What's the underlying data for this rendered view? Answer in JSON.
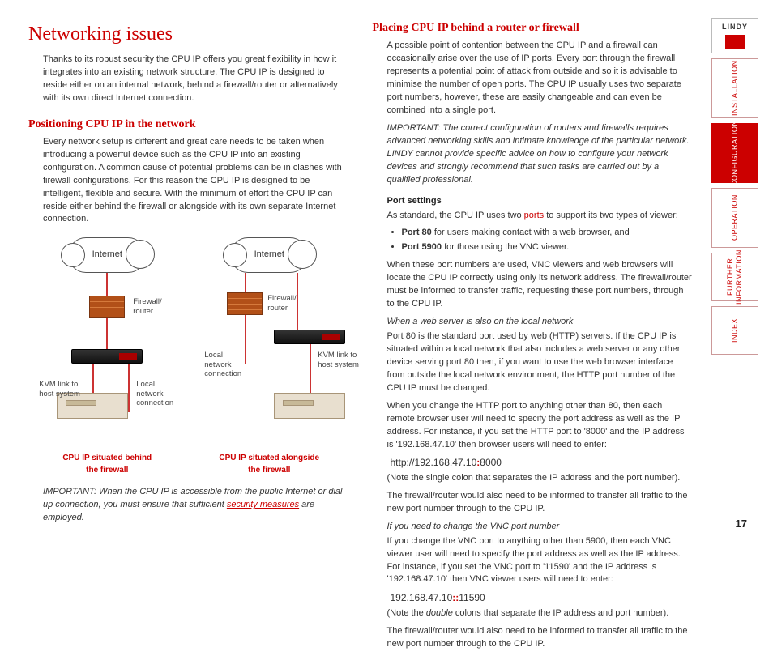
{
  "page_number": "17",
  "logo_text": "LINDY",
  "nav": {
    "installation": "INSTALLATION",
    "configuration": "CONFIGURATION",
    "operation": "OPERATION",
    "further": "FURTHER\nINFORMATION",
    "index": "INDEX"
  },
  "left": {
    "h1": "Networking issues",
    "intro": "Thanks to its robust security the CPU IP offers you great flexibility in how it integrates into an existing network structure. The CPU IP is designed to reside either on an internal network, behind a firewall/router or alternatively with its own direct Internet connection.",
    "h2_a": "Positioning CPU IP in the network",
    "para_a": "Every network setup is different and great care needs to be taken when introducing a powerful device such as the CPU IP into an existing configuration. A common cause of potential problems can be in clashes with firewall configurations. For this reason the CPU IP is designed to be intelligent, flexible and secure. With the minimum of effort the CPU IP can reside either behind the firewall or alongside with its own separate Internet connection.",
    "diagram": {
      "internet": "Internet",
      "fw_router": "Firewall/\nrouter",
      "kvm_link": "KVM link to\nhost system",
      "local_net": "Local\nnetwork\nconnection",
      "caption_left": "CPU IP situated behind\nthe firewall",
      "caption_right": "CPU IP situated alongside\nthe firewall"
    },
    "important_pre": "IMPORTANT: When the CPU IP is accessible from the public Internet or dial up connection, you must ensure that sufficient ",
    "security_link": "security measures",
    "important_post": " are employed."
  },
  "right": {
    "h2_b": "Placing CPU IP behind a router or firewall",
    "para_b1": "A possible point of contention between the CPU IP and a firewall can occasionally arise over the use of IP ports. Every port through the firewall represents a potential point of attack from outside and so it is advisable to minimise the number of open ports. The CPU IP usually uses two separate port numbers, however, these are easily changeable and can even be combined into a single port.",
    "important_b": "IMPORTANT: The correct configuration of routers and firewalls requires advanced networking skills and intimate knowledge of the particular network. LINDY cannot provide specific advice on how to configure your network devices and strongly recommend that such tasks are carried out by a qualified professional.",
    "h3_ports": "Port settings",
    "ports_intro_pre": "As standard, the CPU IP uses two ",
    "ports_link": "ports",
    "ports_intro_post": " to support its two types of viewer:",
    "port80_b": "Port 80",
    "port80_t": " for users making contact with a web browser, and",
    "port5900_b": "Port 5900",
    "port5900_t": " for those using the VNC viewer.",
    "ports_after": "When these port numbers are used, VNC viewers and web browsers will locate the CPU IP correctly using only its network address. The firewall/router must be informed to transfer traffic, requesting these port numbers, through to the CPU IP.",
    "sub_web": "When a web server is also on the local network",
    "web_p1": "Port 80 is the standard port used by web (HTTP) servers. If the CPU IP is situated within a local network that also includes a web server or any other device serving port 80 then, if you want to use the web browser interface from outside the local network environment, the HTTP port number of the CPU IP must be changed.",
    "web_p2": "When you change the HTTP port to anything other than 80, then each remote browser user will need to specify the port address as well as the IP address. For instance, if you set the HTTP port to '8000' and the IP address is '192.168.47.10' then browser users will need to enter:",
    "http_example_pre": "http://192.168.47.10",
    "http_example_colon": ":",
    "http_example_post": "8000",
    "web_note": "(Note the single colon that separates the IP address and the port number).",
    "web_p3": "The firewall/router would also need to be informed to transfer all traffic to the new port number through to the CPU IP.",
    "sub_vnc": "If you need to change the VNC port number",
    "vnc_p1": "If you change the VNC port to anything other than 5900, then each VNC viewer user will need to specify the port address as well as the IP address. For instance, if you set the VNC port to '11590' and the IP address is '192.168.47.10' then VNC viewer users will need to enter:",
    "vnc_example_pre": "192.168.47.10",
    "vnc_example_colon": "::",
    "vnc_example_post": "11590",
    "vnc_note_pre": "(Note the ",
    "vnc_note_em": "double",
    "vnc_note_post": " colons that separate the IP address and port number).",
    "vnc_p2": "The firewall/router would also need to be informed to transfer all traffic to the new port number through to the CPU IP."
  }
}
